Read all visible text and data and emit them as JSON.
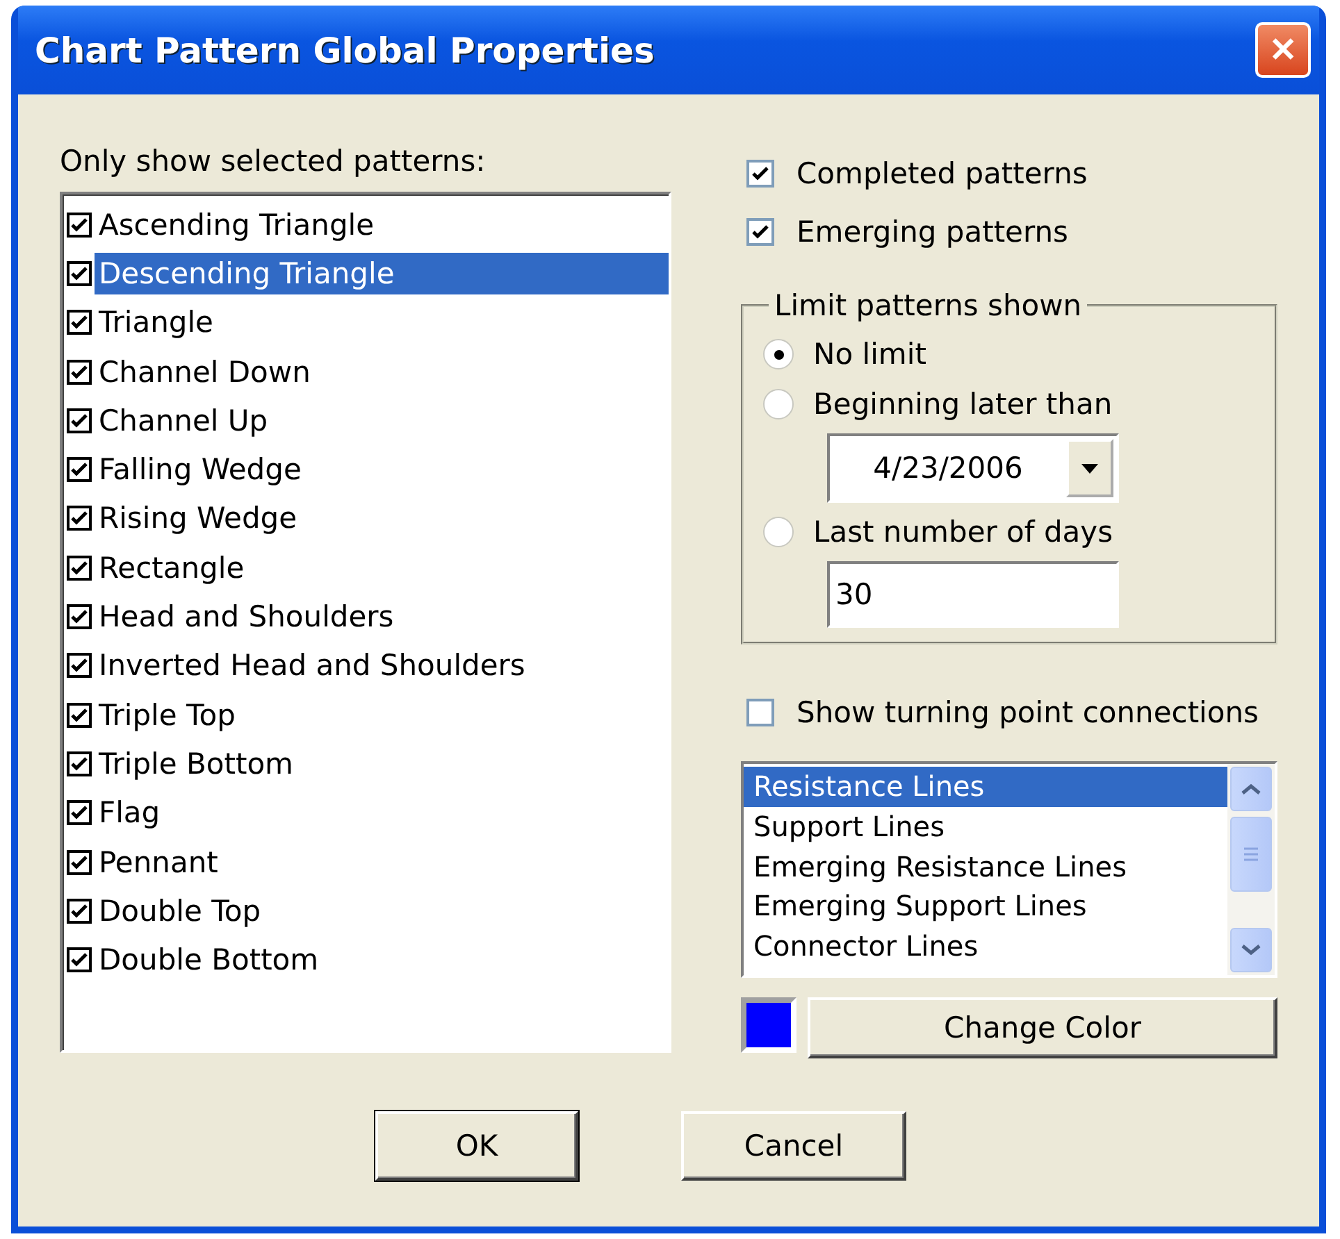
{
  "window": {
    "title": "Chart Pattern Global Properties",
    "close_glyph": "✕"
  },
  "patterns": {
    "label": "Only show selected patterns:",
    "items": [
      {
        "label": "Ascending Triangle",
        "checked": true,
        "selected": false
      },
      {
        "label": "Descending Triangle",
        "checked": true,
        "selected": true
      },
      {
        "label": "Triangle",
        "checked": true,
        "selected": false
      },
      {
        "label": "Channel Down",
        "checked": true,
        "selected": false
      },
      {
        "label": "Channel Up",
        "checked": true,
        "selected": false
      },
      {
        "label": "Falling Wedge",
        "checked": true,
        "selected": false
      },
      {
        "label": "Rising Wedge",
        "checked": true,
        "selected": false
      },
      {
        "label": "Rectangle",
        "checked": true,
        "selected": false
      },
      {
        "label": "Head and Shoulders",
        "checked": true,
        "selected": false
      },
      {
        "label": "Inverted Head and Shoulders",
        "checked": true,
        "selected": false
      },
      {
        "label": "Triple Top",
        "checked": true,
        "selected": false
      },
      {
        "label": "Triple Bottom",
        "checked": true,
        "selected": false
      },
      {
        "label": "Flag",
        "checked": true,
        "selected": false
      },
      {
        "label": "Pennant",
        "checked": true,
        "selected": false
      },
      {
        "label": "Double Top",
        "checked": true,
        "selected": false
      },
      {
        "label": "Double Bottom",
        "checked": true,
        "selected": false
      }
    ]
  },
  "options": [
    {
      "label": "Completed patterns",
      "checked": true
    },
    {
      "label": "Emerging patterns",
      "checked": true
    }
  ],
  "limit": {
    "title": "Limit patterns shown",
    "choices": [
      {
        "label": "No limit",
        "selected": true
      },
      {
        "label": "Beginning later than",
        "selected": false,
        "date": "4/23/2006"
      },
      {
        "label": "Last number of days",
        "selected": false,
        "value": "30"
      }
    ]
  },
  "turning_points": {
    "label": "Show turning point connections",
    "checked": false,
    "lines": [
      {
        "label": "Resistance Lines",
        "selected": true
      },
      {
        "label": "Support Lines",
        "selected": false
      },
      {
        "label": "Emerging Resistance Lines",
        "selected": false
      },
      {
        "label": "Emerging Support Lines",
        "selected": false
      },
      {
        "label": "Connector Lines",
        "selected": false
      }
    ],
    "color": "#0000ff",
    "change_button": "Change Color"
  },
  "buttons": [
    "OK",
    "Cancel"
  ]
}
